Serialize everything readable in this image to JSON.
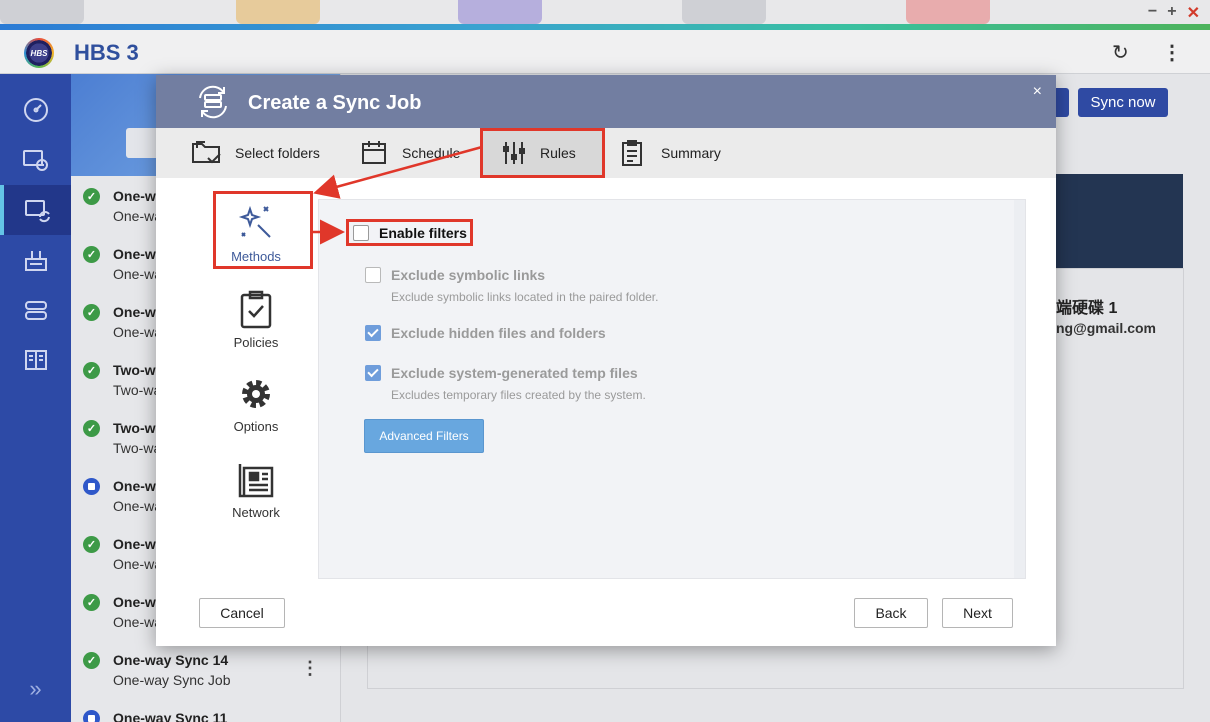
{
  "app": {
    "title": "HBS 3",
    "logo_text": "HBS"
  },
  "window_controls": {
    "minimize": "−",
    "maximize": "+",
    "close": "✕"
  },
  "header_icons": {
    "refresh": "↻",
    "more": "⋮"
  },
  "left_nav": {
    "items": [
      {
        "name": "overview",
        "icon": "dashboard-icon"
      },
      {
        "name": "backup-restore",
        "icon": "backup-icon"
      },
      {
        "name": "sync",
        "icon": "sync-icon",
        "active": true
      },
      {
        "name": "storage-spaces",
        "icon": "storage-icon"
      },
      {
        "name": "services",
        "icon": "server-icon"
      },
      {
        "name": "logs",
        "icon": "logs-icon"
      }
    ],
    "expand_label": "»"
  },
  "jobs": [
    {
      "name": "One-w",
      "type": "One-wa",
      "status": "done"
    },
    {
      "name": "One-w",
      "type": "One-wa",
      "status": "done"
    },
    {
      "name": "One-w",
      "type": "One-wa",
      "status": "done"
    },
    {
      "name": "Two-w",
      "type": "Two-wa",
      "status": "done"
    },
    {
      "name": "Two-w",
      "type": "Two-wa",
      "status": "done"
    },
    {
      "name": "One-w",
      "type": "One-wa",
      "status": "scheduled"
    },
    {
      "name": "One-w",
      "type": "One-wa",
      "status": "done"
    },
    {
      "name": "One-w",
      "type": "One-wa",
      "status": "done"
    },
    {
      "name": "One-way Sync 14",
      "type": "One-way Sync Job",
      "status": "done"
    },
    {
      "name": "One-way Sync 11",
      "type": "",
      "status": "scheduled"
    }
  ],
  "job_more": "⋮",
  "background": {
    "sync_now": "Sync now",
    "storage_name": "端硬碟 1",
    "account": "ng@gmail.com"
  },
  "dialog": {
    "title": "Create a Sync Job",
    "close": "×",
    "steps": [
      {
        "label": "Select folders",
        "icon": "folders-icon"
      },
      {
        "label": "Schedule",
        "icon": "calendar-icon"
      },
      {
        "label": "Rules",
        "icon": "sliders-icon",
        "active": true
      },
      {
        "label": "Summary",
        "icon": "clipboard-icon"
      }
    ],
    "categories": [
      {
        "label": "Methods",
        "icon": "magic-wand-icon",
        "active": true
      },
      {
        "label": "Policies",
        "icon": "clipboard-check-icon"
      },
      {
        "label": "Options",
        "icon": "gear-icon"
      },
      {
        "label": "Network",
        "icon": "network-icon"
      }
    ],
    "filters": {
      "enable_label": "Enable filters",
      "enable_checked": false,
      "options": [
        {
          "label": "Exclude symbolic links",
          "checked": false,
          "description": "Exclude symbolic links located in the paired folder."
        },
        {
          "label": "Exclude hidden files and folders",
          "checked": true,
          "description": ""
        },
        {
          "label": "Exclude system-generated temp files",
          "checked": true,
          "description": "Excludes temporary files created by the system."
        }
      ],
      "advanced_button": "Advanced Filters"
    },
    "footer": {
      "cancel": "Cancel",
      "back": "Back",
      "next": "Next"
    }
  },
  "colors": {
    "nav_bg": "#2d4aa6",
    "dialog_header": "#727ea1",
    "highlight": "#e0372a",
    "primary_button": "#2f4aa3",
    "checkbox_on": "#6f9ddb"
  }
}
